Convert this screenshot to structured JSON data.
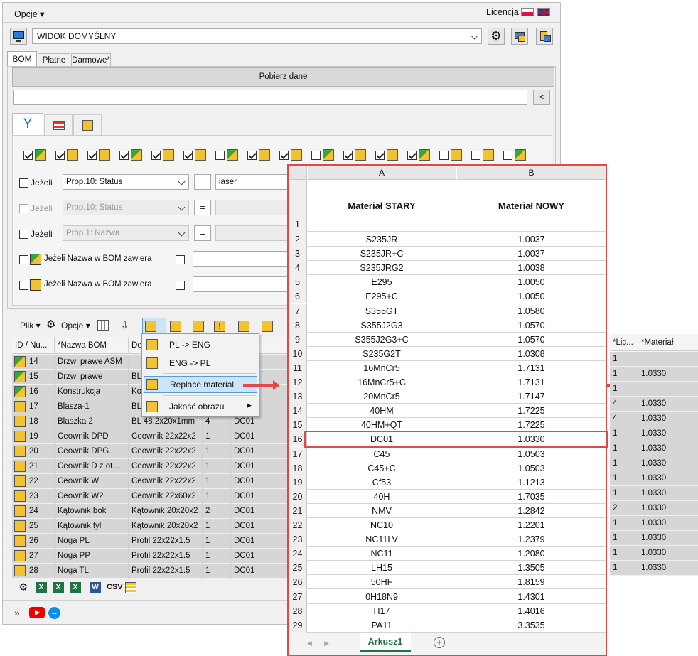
{
  "menubar": {
    "options": "Opcje",
    "license": "Licencja"
  },
  "view": {
    "selected": "WIDOK DOMYŚLNY"
  },
  "tabs": [
    "BOM",
    "Płatne",
    "Darmowe*"
  ],
  "fetch_button": "Pobierz dane",
  "search": {
    "value": "",
    "collapse": "<"
  },
  "filters": [
    {
      "label": "Jeżeli",
      "prop": "Prop.10: Status",
      "op": "=",
      "value": "laser"
    },
    {
      "label": "Jeżeli",
      "prop": "Prop.10: Status",
      "op": "=",
      "value": ""
    },
    {
      "label": "Jeżeli",
      "prop": "Prop.1: Nazwa",
      "op": "=",
      "value": ""
    }
  ],
  "name_filters": [
    "Jeżeli Nazwa w BOM zawiera",
    "Jeżeli Nazwa w BOM zawiera"
  ],
  "toolbar": {
    "file": "Plik",
    "options": "Opcje"
  },
  "menu": {
    "items": [
      "PL -> ENG",
      "ENG -> PL",
      "Replace material",
      "Jakość obrazu"
    ]
  },
  "grid": {
    "headers": [
      "ID / Nu...",
      "*Nazwa BOM",
      "Des",
      ""
    ],
    "right_headers": [
      "*Lic...",
      "*Materiał"
    ],
    "rows": [
      {
        "id": "14",
        "name": "Drzwi prawe ASM",
        "desc": "",
        "qty": "",
        "mat": "",
        "lic": "1",
        "material": ""
      },
      {
        "id": "15",
        "name": "Drzwi prawe",
        "desc": "BL 6",
        "qty": "",
        "mat": "",
        "lic": "1",
        "material": "1.0330"
      },
      {
        "id": "16",
        "name": "Konstrukcja",
        "desc": "Kon",
        "qty": "",
        "mat": "",
        "lic": "1",
        "material": ""
      },
      {
        "id": "17",
        "name": "Blasza-1",
        "desc": "BL 5",
        "qty": "",
        "mat": "",
        "lic": "4",
        "material": "1.0330"
      },
      {
        "id": "18",
        "name": "Blaszka 2",
        "desc": "BL 48.2x20x1mm",
        "qty": "4",
        "mat": "DC01",
        "lic": "4",
        "material": "1.0330"
      },
      {
        "id": "19",
        "name": "Ceownik DPD",
        "desc": "Ceownik 22x22x2",
        "qty": "1",
        "mat": "DC01",
        "lic": "1",
        "material": "1.0330"
      },
      {
        "id": "20",
        "name": "Ceownik DPG",
        "desc": "Ceownik 22x22x2",
        "qty": "1",
        "mat": "DC01",
        "lic": "1",
        "material": "1.0330"
      },
      {
        "id": "21",
        "name": "Ceownik D z ot...",
        "desc": "Ceownik 22x22x2",
        "qty": "1",
        "mat": "DC01",
        "lic": "1",
        "material": "1.0330"
      },
      {
        "id": "22",
        "name": "Ceownik W",
        "desc": "Ceownik 22x22x2",
        "qty": "1",
        "mat": "DC01",
        "lic": "1",
        "material": "1.0330"
      },
      {
        "id": "23",
        "name": "Ceownik W2",
        "desc": "Ceownik 22x60x2",
        "qty": "1",
        "mat": "DC01",
        "lic": "1",
        "material": "1.0330"
      },
      {
        "id": "24",
        "name": "Kątownik bok",
        "desc": "Kątownik 20x20x2",
        "qty": "2",
        "mat": "DC01",
        "lic": "2",
        "material": "1.0330"
      },
      {
        "id": "25",
        "name": "Kątownik tył",
        "desc": "Kątownik 20x20x2",
        "qty": "1",
        "mat": "DC01",
        "lic": "1",
        "material": "1.0330"
      },
      {
        "id": "26",
        "name": "Noga PL",
        "desc": "Profil 22x22x1.5",
        "qty": "1",
        "mat": "DC01",
        "lic": "1",
        "material": "1.0330"
      },
      {
        "id": "27",
        "name": "Noga PP",
        "desc": "Profil 22x22x1.5",
        "qty": "1",
        "mat": "DC01",
        "lic": "1",
        "material": "1.0330"
      },
      {
        "id": "28",
        "name": "Noga TL",
        "desc": "Profil 22x22x1.5",
        "qty": "1",
        "mat": "DC01",
        "lic": "1",
        "material": "1.0330"
      }
    ]
  },
  "bottom": {
    "csv": "CSV"
  },
  "sheet": {
    "col_a": "A",
    "col_b": "B",
    "header_a": "Materiał STARY",
    "header_b": "Materiał NOWY",
    "header_row": "1",
    "rows": [
      [
        "2",
        "S235JR",
        "1.0037"
      ],
      [
        "3",
        "S235JR+C",
        "1.0037"
      ],
      [
        "4",
        "S235JRG2",
        "1.0038"
      ],
      [
        "5",
        "E295",
        "1.0050"
      ],
      [
        "6",
        "E295+C",
        "1.0050"
      ],
      [
        "7",
        "S355GT",
        "1.0580"
      ],
      [
        "8",
        "S355J2G3",
        "1.0570"
      ],
      [
        "9",
        "S355J2G3+C",
        "1.0570"
      ],
      [
        "10",
        "S235G2T",
        "1.0308"
      ],
      [
        "11",
        "16MnCr5",
        "1.7131"
      ],
      [
        "12",
        "16MnCr5+C",
        "1.7131"
      ],
      [
        "13",
        "20MnCr5",
        "1.7147"
      ],
      [
        "14",
        "40HM",
        "1.7225"
      ],
      [
        "15",
        "40HM+QT",
        "1.7225"
      ],
      [
        "16",
        "DC01",
        "1.0330"
      ],
      [
        "17",
        "C45",
        "1.0503"
      ],
      [
        "18",
        "C45+C",
        "1.0503"
      ],
      [
        "19",
        "Cf53",
        "1.1213"
      ],
      [
        "20",
        "40H",
        "1.7035"
      ],
      [
        "21",
        "NMV",
        "1.2842"
      ],
      [
        "22",
        "NC10",
        "1.2201"
      ],
      [
        "23",
        "NC11LV",
        "1.2379"
      ],
      [
        "24",
        "NC11",
        "1.2080"
      ],
      [
        "25",
        "LH15",
        "1.3505"
      ],
      [
        "26",
        "50HF",
        "1.8159"
      ],
      [
        "27",
        "0H18N9",
        "1.4301"
      ],
      [
        "28",
        "H17",
        "1.4016"
      ],
      [
        "29",
        "PA11",
        "3.3535"
      ]
    ],
    "tab": "Arkusz1"
  },
  "colors": {
    "highlight": "#e24848",
    "grid_row": "#d6d6d6",
    "sheet_tab": "#217346"
  }
}
